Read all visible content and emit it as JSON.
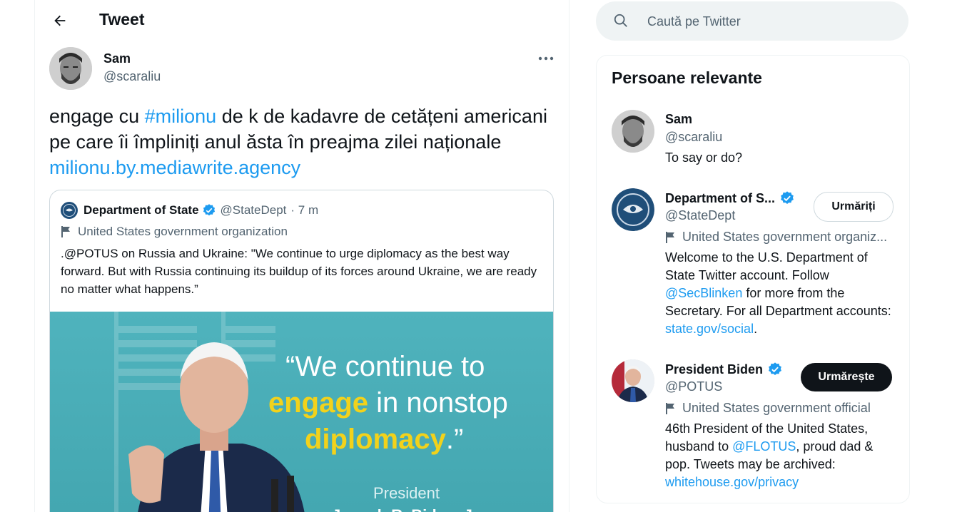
{
  "colors": {
    "accent": "#1d9bf0",
    "text": "#0f1419",
    "muted": "#536471",
    "border": "#eff3f4",
    "quote_image_bg": "#4fb3bd",
    "quote_highlight": "#f2d21b"
  },
  "header": {
    "title": "Tweet",
    "back_icon": "arrow-left-icon"
  },
  "tweet": {
    "author_name": "Sam",
    "author_handle": "@scaraliu",
    "more_icon": "more-horizontal-icon",
    "text_part1": "engage cu ",
    "hashtag": "#milionu",
    "text_part2": " de k de kadavre de cetățeni americani pe care îi împliniți anul ăsta în preajma zilei naționale ",
    "url": "milionu.by.mediawrite.agency"
  },
  "quoted_tweet": {
    "author_name": "Department of State",
    "author_handle": "@StateDept",
    "time": "· 7 m",
    "label": "United States government organization",
    "text": ".@POTUS on Russia and Ukraine: \"We continue to urge diplomacy as the best way forward. But with Russia continuing its buildup of its forces around Ukraine, we are ready no matter what happens.”",
    "image": {
      "line1": "“We continue to",
      "line2_highlight": "engage",
      "line2_rest": " in nonstop",
      "line3_highlight": "diplomacy",
      "line3_rest": ".”",
      "caption1": "President",
      "caption2": "Joseph R. Biden, Jr."
    }
  },
  "search": {
    "placeholder": "Caută pe Twitter",
    "icon": "search-icon"
  },
  "relevant": {
    "title": "Persoane relevante",
    "people": [
      {
        "name": "Sam",
        "handle": "@scaraliu",
        "bio": "To say or do?"
      },
      {
        "name": "Department of S...",
        "handle": "@StateDept",
        "label": "United States government organiz...",
        "bio_1": "Welcome to the U.S. Department of State Twitter account. Follow ",
        "bio_link1": "@SecBlinken",
        "bio_2": " for more from the Secretary. For all Department accounts: ",
        "bio_link2": "state.gov/social",
        "bio_3": ".",
        "button": "Urmăriți"
      },
      {
        "name": "President Biden",
        "handle": "@POTUS",
        "label": "United States government official",
        "bio_1": "46th President of the United States, husband to ",
        "bio_link1": "@FLOTUS",
        "bio_2": ", proud dad & pop. Tweets may be archived: ",
        "bio_link2": "whitehouse.gov/privacy",
        "button": "Urmărește"
      }
    ]
  }
}
